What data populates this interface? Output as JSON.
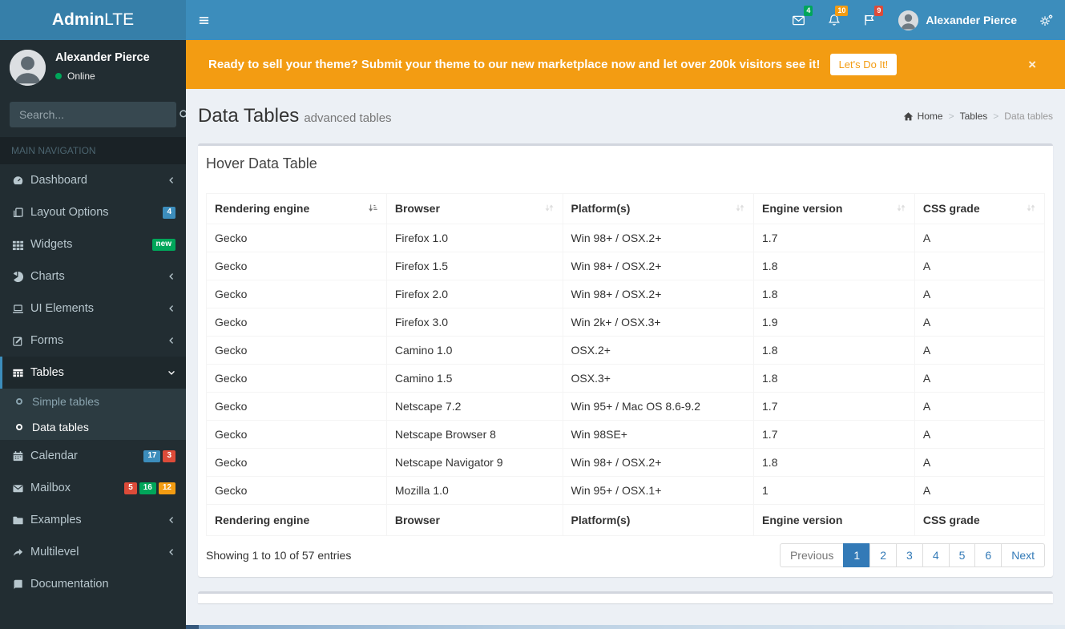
{
  "brand": {
    "bold": "Admin",
    "light": "LTE"
  },
  "navbar": {
    "items": [
      {
        "name": "messages",
        "icon": "envelope-icon",
        "badge": "4",
        "badge_color": "#00a65a"
      },
      {
        "name": "notifications",
        "icon": "bell-icon",
        "badge": "10",
        "badge_color": "#f39c12"
      },
      {
        "name": "flags",
        "icon": "flag-icon",
        "badge": "9",
        "badge_color": "#dd4b39"
      }
    ],
    "user_name": "Alexander Pierce"
  },
  "banner": {
    "message": "Ready to sell your theme? Submit your theme to our new marketplace now and let over 200k visitors see it!",
    "button_label": "Let's Do It!",
    "close_label": "×"
  },
  "sidebar": {
    "user": {
      "name": "Alexander Pierce",
      "status": "Online"
    },
    "search": {
      "placeholder": "Search..."
    },
    "section_header": "MAIN NAVIGATION",
    "items": [
      {
        "label": "Dashboard",
        "icon": "dashboard-icon",
        "chevron": true
      },
      {
        "label": "Layout Options",
        "icon": "layout-options-icon",
        "badges": [
          {
            "text": "4",
            "color": "#3c8dbc"
          }
        ]
      },
      {
        "label": "Widgets",
        "icon": "widgets-icon",
        "badges": [
          {
            "text": "new",
            "color": "#00a65a"
          }
        ]
      },
      {
        "label": "Charts",
        "icon": "charts-icon",
        "chevron": true
      },
      {
        "label": "UI Elements",
        "icon": "ui-elements-icon",
        "chevron": true
      },
      {
        "label": "Forms",
        "icon": "forms-icon",
        "chevron": true
      },
      {
        "label": "Tables",
        "icon": "tables-icon",
        "active": true,
        "expanded": true,
        "children": [
          {
            "label": "Simple tables"
          },
          {
            "label": "Data tables",
            "active": true
          }
        ]
      },
      {
        "label": "Calendar",
        "icon": "calendar-icon",
        "badges": [
          {
            "text": "17",
            "color": "#3c8dbc"
          },
          {
            "text": "3",
            "color": "#dd4b39"
          }
        ]
      },
      {
        "label": "Mailbox",
        "icon": "mailbox-icon",
        "badges": [
          {
            "text": "5",
            "color": "#dd4b39"
          },
          {
            "text": "16",
            "color": "#00a65a"
          },
          {
            "text": "12",
            "color": "#f39c12"
          }
        ]
      },
      {
        "label": "Examples",
        "icon": "examples-icon",
        "chevron": true
      },
      {
        "label": "Multilevel",
        "icon": "multilevel-icon",
        "chevron": true
      },
      {
        "label": "Documentation",
        "icon": "documentation-icon"
      }
    ]
  },
  "page": {
    "title": "Data Tables",
    "subtitle": "advanced tables",
    "breadcrumb": [
      {
        "label": "Home",
        "icon": "home-icon",
        "link": true
      },
      {
        "label": "Tables",
        "link": true
      },
      {
        "label": "Data tables",
        "link": false
      }
    ]
  },
  "box": {
    "title": "Hover Data Table",
    "table": {
      "headers": [
        "Rendering engine",
        "Browser",
        "Platform(s)",
        "Engine version",
        "CSS grade"
      ],
      "sorted_column": 0,
      "col_widths": [
        "21.5%",
        "21%",
        "22.8%",
        "19.2%",
        "15.5%"
      ],
      "rows": [
        [
          "Gecko",
          "Firefox 1.0",
          "Win 98+ / OSX.2+",
          "1.7",
          "A"
        ],
        [
          "Gecko",
          "Firefox 1.5",
          "Win 98+ / OSX.2+",
          "1.8",
          "A"
        ],
        [
          "Gecko",
          "Firefox 2.0",
          "Win 98+ / OSX.2+",
          "1.8",
          "A"
        ],
        [
          "Gecko",
          "Firefox 3.0",
          "Win 2k+ / OSX.3+",
          "1.9",
          "A"
        ],
        [
          "Gecko",
          "Camino 1.0",
          "OSX.2+",
          "1.8",
          "A"
        ],
        [
          "Gecko",
          "Camino 1.5",
          "OSX.3+",
          "1.8",
          "A"
        ],
        [
          "Gecko",
          "Netscape 7.2",
          "Win 95+ / Mac OS 8.6-9.2",
          "1.7",
          "A"
        ],
        [
          "Gecko",
          "Netscape Browser 8",
          "Win 98SE+",
          "1.7",
          "A"
        ],
        [
          "Gecko",
          "Netscape Navigator 9",
          "Win 98+ / OSX.2+",
          "1.8",
          "A"
        ],
        [
          "Gecko",
          "Mozilla 1.0",
          "Win 95+ / OSX.1+",
          "1",
          "A"
        ]
      ],
      "footer": [
        "Rendering engine",
        "Browser",
        "Platform(s)",
        "Engine version",
        "CSS grade"
      ]
    },
    "info": "Showing 1 to 10 of 57 entries",
    "pagination": [
      {
        "label": "Previous",
        "state": "disabled"
      },
      {
        "label": "1",
        "state": "active"
      },
      {
        "label": "2",
        "state": "normal"
      },
      {
        "label": "3",
        "state": "normal"
      },
      {
        "label": "4",
        "state": "normal"
      },
      {
        "label": "5",
        "state": "normal"
      },
      {
        "label": "6",
        "state": "normal"
      },
      {
        "label": "Next",
        "state": "normal"
      }
    ]
  },
  "colors": {
    "navbar": "#3c8dbc",
    "logo": "#367fa9",
    "sidebar": "#222d32",
    "banner": "#f39c12",
    "pagination_active": "#337ab7",
    "sidebar_active_border": "#3c8dbc"
  }
}
